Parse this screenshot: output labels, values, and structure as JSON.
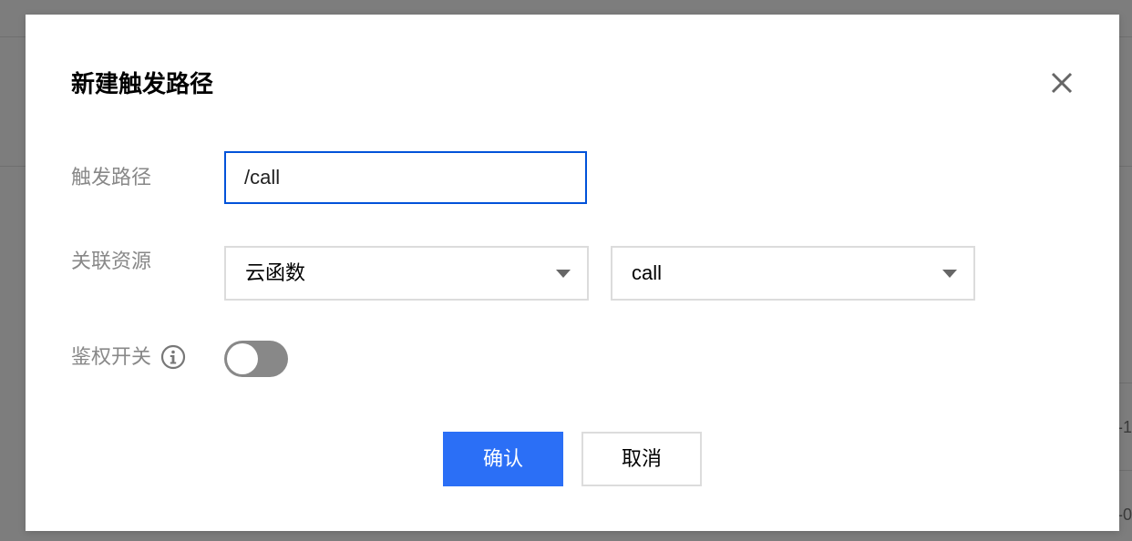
{
  "dialog": {
    "title": "新建触发路径",
    "close_icon": "close-icon"
  },
  "form": {
    "path": {
      "label": "触发路径",
      "value": "/call"
    },
    "resource": {
      "label": "关联资源",
      "type_value": "云函数",
      "name_value": "call"
    },
    "auth": {
      "label": "鉴权开关",
      "info_icon": "info-icon",
      "enabled": false
    }
  },
  "buttons": {
    "confirm_label": "确认",
    "cancel_label": "取消"
  },
  "background": {
    "partial_text_1": "-1",
    "partial_text_2": "-0"
  },
  "colors": {
    "primary": "#2b6ff6",
    "input_focus_border": "#0052d9",
    "toggle_off": "#888888",
    "label": "#888888"
  }
}
